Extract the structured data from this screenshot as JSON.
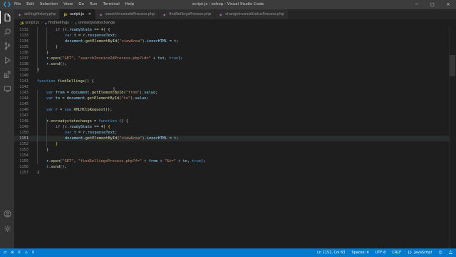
{
  "window": {
    "title": "script.js - eshop - Visual Studio Code",
    "menu": [
      "File",
      "Edit",
      "Selection",
      "View",
      "Go",
      "Run",
      "Terminal",
      "Help"
    ]
  },
  "tabs": [
    {
      "label": "sellingHistory.php",
      "icon": "php-file-icon",
      "active": false
    },
    {
      "label": "script.js",
      "icon": "js-file-icon",
      "active": true
    },
    {
      "label": "searchInvoiceIdProcess.php",
      "icon": "php-file-icon",
      "active": false
    },
    {
      "label": "findSellingsProcess.php",
      "icon": "php-file-icon",
      "active": false
    },
    {
      "label": "changeInvoiceStatusProcess.php",
      "icon": "php-file-icon",
      "active": false
    }
  ],
  "breadcrumb": {
    "file": "script.js",
    "function": "findSellings",
    "symbol": "onreadystatechange"
  },
  "editor": {
    "current_line": "1151",
    "lines": [
      {
        "n": "1132",
        "tokens": [
          [
            "t-kw",
            "if "
          ],
          [
            "t-p",
            "("
          ],
          [
            "t-var",
            "r"
          ],
          [
            "t-p",
            "."
          ],
          [
            "t-var",
            "readyState"
          ],
          [
            "t-p",
            " == "
          ],
          [
            "t-num",
            "4"
          ],
          [
            "t-p",
            ") {"
          ]
        ],
        "indent": 2
      },
      {
        "n": "1133",
        "tokens": [
          [
            "t-st",
            "var "
          ],
          [
            "t-var",
            "t"
          ],
          [
            "t-p",
            " = "
          ],
          [
            "t-var",
            "r"
          ],
          [
            "t-p",
            "."
          ],
          [
            "t-var",
            "responseText"
          ],
          [
            "t-p",
            ";"
          ]
        ],
        "indent": 3
      },
      {
        "n": "1134",
        "tokens": [
          [
            "t-var",
            "document"
          ],
          [
            "t-p",
            "."
          ],
          [
            "t-fn",
            "getElementById"
          ],
          [
            "t-p",
            "("
          ],
          [
            "t-str",
            "\"viewArea\""
          ],
          [
            "t-p",
            ")."
          ],
          [
            "t-var",
            "innerHTML"
          ],
          [
            "t-p",
            " = "
          ],
          [
            "t-var",
            "t"
          ],
          [
            "t-p",
            ";"
          ]
        ],
        "indent": 3
      },
      {
        "n": "1135",
        "tokens": [
          [
            "t-p",
            "}"
          ]
        ],
        "indent": 2
      },
      {
        "n": "1136",
        "tokens": [
          [
            "t-p",
            "}"
          ]
        ],
        "indent": 1
      },
      {
        "n": "1137",
        "tokens": [
          [
            "t-var",
            "r"
          ],
          [
            "t-p",
            "."
          ],
          [
            "t-fn",
            "open"
          ],
          [
            "t-p",
            "("
          ],
          [
            "t-str",
            "\"GET\""
          ],
          [
            "t-p",
            ", "
          ],
          [
            "t-str",
            "\"searchInvoiceIdProcess.php?id=\""
          ],
          [
            "t-p",
            " + "
          ],
          [
            "t-var",
            "txt"
          ],
          [
            "t-p",
            ", "
          ],
          [
            "t-st",
            "true"
          ],
          [
            "t-p",
            ");"
          ]
        ],
        "indent": 1
      },
      {
        "n": "1138",
        "tokens": [
          [
            "t-var",
            "r"
          ],
          [
            "t-p",
            "."
          ],
          [
            "t-fn",
            "send"
          ],
          [
            "t-p",
            "();"
          ]
        ],
        "indent": 1
      },
      {
        "n": "1139",
        "tokens": [
          [
            "t-p",
            "}"
          ]
        ],
        "indent": 0
      },
      {
        "n": "1140",
        "tokens": [],
        "indent": 0
      },
      {
        "n": "1141",
        "tokens": [
          [
            "t-st",
            "function "
          ],
          [
            "t-fn",
            "findSellings"
          ],
          [
            "t-p",
            "() {"
          ]
        ],
        "indent": 0
      },
      {
        "n": "1142",
        "tokens": [],
        "indent": 0
      },
      {
        "n": "1143",
        "tokens": [
          [
            "t-st",
            "var "
          ],
          [
            "t-var",
            "from"
          ],
          [
            "t-p",
            " = "
          ],
          [
            "t-var",
            "document"
          ],
          [
            "t-p",
            "."
          ],
          [
            "t-fn",
            "getElementById"
          ],
          [
            "t-p",
            "("
          ],
          [
            "t-str",
            "\"from\""
          ],
          [
            "t-p",
            ")."
          ],
          [
            "t-var",
            "value"
          ],
          [
            "t-p",
            ";"
          ]
        ],
        "indent": 1
      },
      {
        "n": "1144",
        "tokens": [
          [
            "t-st",
            "var "
          ],
          [
            "t-var",
            "to"
          ],
          [
            "t-p",
            " = "
          ],
          [
            "t-var",
            "document"
          ],
          [
            "t-p",
            "."
          ],
          [
            "t-fn",
            "getElementById"
          ],
          [
            "t-p",
            "("
          ],
          [
            "t-str",
            "\"to\""
          ],
          [
            "t-p",
            ")."
          ],
          [
            "t-var",
            "value"
          ],
          [
            "t-p",
            ";"
          ]
        ],
        "indent": 1
      },
      {
        "n": "1145",
        "tokens": [],
        "indent": 0
      },
      {
        "n": "1146",
        "tokens": [
          [
            "t-st",
            "var "
          ],
          [
            "t-var",
            "r"
          ],
          [
            "t-p",
            " = "
          ],
          [
            "t-st",
            "new "
          ],
          [
            "t-fn",
            "XMLHttpRequest"
          ],
          [
            "t-p",
            "();"
          ]
        ],
        "indent": 1
      },
      {
        "n": "1147",
        "tokens": [],
        "indent": 0
      },
      {
        "n": "1148",
        "tokens": [
          [
            "t-var",
            "r"
          ],
          [
            "t-p",
            "."
          ],
          [
            "t-fn",
            "onreadystatechange"
          ],
          [
            "t-p",
            " = "
          ],
          [
            "t-st",
            "function "
          ],
          [
            "t-p",
            "() {"
          ]
        ],
        "indent": 1
      },
      {
        "n": "1149",
        "tokens": [
          [
            "t-kw",
            "if "
          ],
          [
            "t-p",
            "("
          ],
          [
            "t-var",
            "r"
          ],
          [
            "t-p",
            "."
          ],
          [
            "t-var",
            "readyState"
          ],
          [
            "t-p",
            " == "
          ],
          [
            "t-num",
            "4"
          ],
          [
            "t-p",
            ") "
          ],
          [
            "t-br",
            "{"
          ]
        ],
        "indent": 2
      },
      {
        "n": "1150",
        "tokens": [
          [
            "t-st",
            "var "
          ],
          [
            "t-var",
            "t"
          ],
          [
            "t-p",
            " = "
          ],
          [
            "t-var",
            "r"
          ],
          [
            "t-p",
            "."
          ],
          [
            "t-var",
            "responseText"
          ],
          [
            "t-p",
            ";"
          ]
        ],
        "indent": 3
      },
      {
        "n": "1151",
        "tokens": [
          [
            "t-var",
            "document"
          ],
          [
            "t-p",
            "."
          ],
          [
            "t-fn",
            "getElementById"
          ],
          [
            "t-p",
            "("
          ],
          [
            "t-str",
            "\"viewArea\""
          ],
          [
            "t-p",
            ")."
          ],
          [
            "t-var",
            "innerHTML"
          ],
          [
            "t-p",
            " = "
          ],
          [
            "t-var",
            "t"
          ],
          [
            "t-p",
            ";"
          ]
        ],
        "indent": 3
      },
      {
        "n": "1152",
        "tokens": [
          [
            "t-br",
            "}"
          ]
        ],
        "indent": 2
      },
      {
        "n": "1153",
        "tokens": [
          [
            "t-p",
            "}"
          ]
        ],
        "indent": 1
      },
      {
        "n": "1154",
        "tokens": [],
        "indent": 0
      },
      {
        "n": "1155",
        "tokens": [
          [
            "t-var",
            "r"
          ],
          [
            "t-p",
            "."
          ],
          [
            "t-fn",
            "open"
          ],
          [
            "t-p",
            "("
          ],
          [
            "t-str",
            "\"GET\""
          ],
          [
            "t-p",
            ", "
          ],
          [
            "t-str",
            "\"findSellingsProcess.php?f=\""
          ],
          [
            "t-p",
            " + "
          ],
          [
            "t-var",
            "from"
          ],
          [
            "t-p",
            " + "
          ],
          [
            "t-str",
            "\"&t=\""
          ],
          [
            "t-p",
            " + "
          ],
          [
            "t-var",
            "to"
          ],
          [
            "t-p",
            ", "
          ],
          [
            "t-st",
            "true"
          ],
          [
            "t-p",
            ");"
          ]
        ],
        "indent": 1
      },
      {
        "n": "1156",
        "tokens": [
          [
            "t-var",
            "r"
          ],
          [
            "t-p",
            "."
          ],
          [
            "t-fn",
            "send"
          ],
          [
            "t-p",
            "();"
          ]
        ],
        "indent": 1
      },
      {
        "n": "1157",
        "tokens": [
          [
            "t-p",
            "}"
          ]
        ],
        "indent": 0
      }
    ]
  },
  "statusbar": {
    "errors": "0",
    "warnings": "0",
    "position": "Ln 1151, Col 63",
    "spaces": "Spaces: 4",
    "encoding": "UTF-8",
    "eol": "CRLF",
    "language": "JavaScript"
  },
  "colors": {
    "accent": "#007acc",
    "titlebar": "#3c3c3c",
    "activitybar": "#333333",
    "editor_bg": "#1e1e1e"
  }
}
